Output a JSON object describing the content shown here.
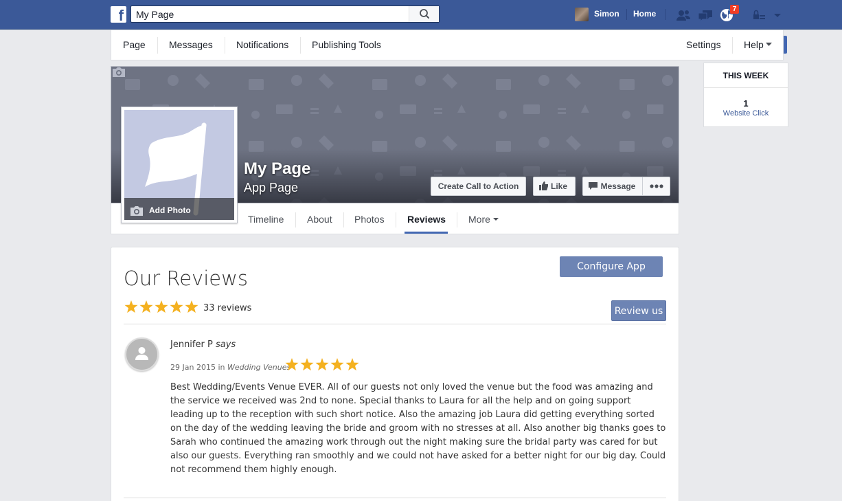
{
  "topbar": {
    "search_value": "My Page",
    "user_name": "Simon",
    "home_label": "Home",
    "notif_count": "7",
    "icons": [
      "friends-icon",
      "messages-icon",
      "globe-icon",
      "privacy-lock-icon",
      "account-caret-icon"
    ]
  },
  "pagenav": {
    "items": [
      "Page",
      "Messages",
      "Notifications",
      "Publishing Tools"
    ],
    "settings_label": "Settings",
    "help_label": "Help"
  },
  "thisweek": {
    "heading": "THIS WEEK",
    "count": "1",
    "label": "Website Click"
  },
  "cover": {
    "page_name": "My Page",
    "page_category": "App Page",
    "add_photo_label": "Add Photo",
    "buttons": {
      "cta": "Create Call to Action",
      "like": "Like",
      "message": "Message"
    }
  },
  "tabs": {
    "items": [
      "Timeline",
      "About",
      "Photos",
      "Reviews",
      "More"
    ],
    "active": "Reviews"
  },
  "reviews": {
    "title": "Our Reviews",
    "configure_label": "Configure App",
    "review_us_label": "Review us",
    "rating": 5,
    "count_text": "33 reviews",
    "entry": {
      "author": "Jennifer P",
      "says": "says",
      "date": "29 Jan 2015",
      "in_word": "in",
      "category": "Wedding Venues",
      "rating": 5,
      "text": "Best Wedding/Events Venue EVER. All of our guests not only loved the venue but the food was amazing and the service we received was 2nd to none. Special thanks to Laura for all the help and on going support leading up to the reception with such short notice. Also the amazing job Laura did getting everything sorted on the day of the wedding leaving the bride and groom with no stresses at all. Also another big thanks goes to Sarah who continued the amazing work through out the night making sure the bridal party was cared for but also our guests. Everything ran smoothly and we could not have asked for a better night for our big day. Could not recommend them highly enough."
    }
  },
  "colors": {
    "brand_blue": "#3b5998",
    "button_blue": "#6d84b4",
    "star_gold": "#f4b120",
    "badge_red": "#f03d25"
  }
}
